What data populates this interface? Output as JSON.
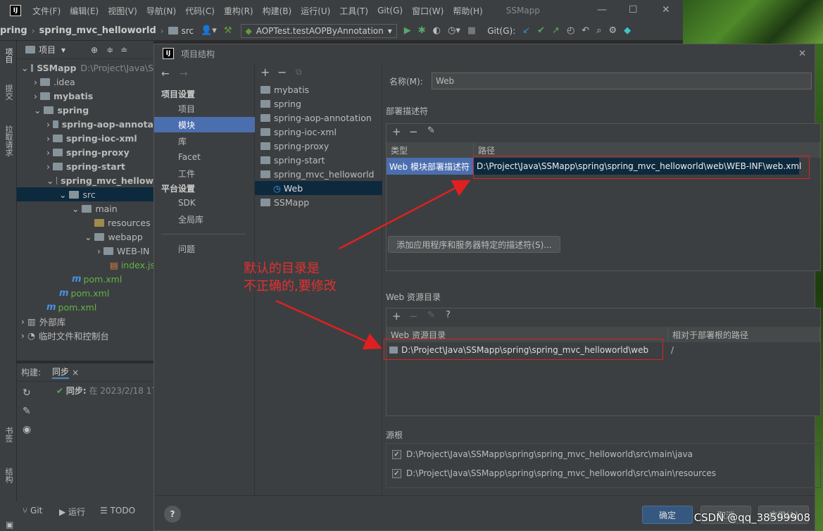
{
  "menubar": {
    "logo": "IJ",
    "items": [
      "文件(F)",
      "编辑(E)",
      "视图(V)",
      "导航(N)",
      "代码(C)",
      "重构(R)",
      "构建(B)",
      "运行(U)",
      "工具(T)",
      "Git(G)",
      "窗口(W)",
      "帮助(H)"
    ],
    "app_title": "SSMapp"
  },
  "toolbar": {
    "crumb1": "pring",
    "crumb2": "spring_mvc_helloworld",
    "crumb3": "src",
    "run_config": "AOPTest.testAOPByAnnotation",
    "git_label": "Git(G):"
  },
  "left_strip": {
    "tab_project": "项目",
    "tab_commit": "提交",
    "tab_pr": "拉取请求",
    "tab_bookmarks": "书签",
    "tab_structure": "结构"
  },
  "project_panel": {
    "header": "项目",
    "rows": [
      {
        "text": "SSMapp",
        "extra": "D:\\Project\\Java\\S"
      },
      {
        "text": ".idea"
      },
      {
        "text": "mybatis"
      },
      {
        "text": "spring"
      },
      {
        "text": "spring-aop-annota"
      },
      {
        "text": "spring-ioc-xml"
      },
      {
        "text": "spring-proxy"
      },
      {
        "text": "spring-start"
      },
      {
        "text": "spring_mvc_hellow"
      },
      {
        "text": "src"
      },
      {
        "text": "main"
      },
      {
        "text": "resources"
      },
      {
        "text": "webapp"
      },
      {
        "text": "WEB-IN"
      },
      {
        "text": "index.js"
      },
      {
        "text": "pom.xml"
      },
      {
        "text": "pom.xml"
      },
      {
        "text": "pom.xml"
      },
      {
        "text": "外部库"
      },
      {
        "text": "临时文件和控制台"
      }
    ]
  },
  "build_panel": {
    "tab_build": "构建:",
    "tab_sync": "同步",
    "sync_status": "同步:",
    "sync_time": "在 2023/2/18 17"
  },
  "statusbar": {
    "git": "Git",
    "run": "运行",
    "todo": "TODO"
  },
  "dialog": {
    "title": "项目结构",
    "logo": "IJ",
    "nav": {
      "project_settings": "项目设置",
      "items1": [
        "项目",
        "模块",
        "库",
        "Facet",
        "工件"
      ],
      "platform_settings": "平台设置",
      "items2": [
        "SDK",
        "全局库"
      ],
      "problems": "问题"
    },
    "modules": [
      "mybatis",
      "spring",
      "spring-aop-annotation",
      "spring-ioc-xml",
      "spring-proxy",
      "spring-start",
      "spring_mvc_helloworld",
      "Web",
      "SSMapp"
    ],
    "name_label": "名称(M):",
    "name_value": "Web",
    "deploy_section": "部署描述符",
    "deploy_headers": {
      "type": "类型",
      "path": "路径"
    },
    "deploy_row": {
      "type": "Web 模块部署描述符",
      "path": "D:\\Project\\Java\\SSMapp\\spring\\spring_mvc_helloworld\\web\\WEB-INF\\web.xml"
    },
    "add_descriptor_btn": "添加应用程序和服务器特定的描述符(S)...",
    "webres_section": "Web 资源目录",
    "webres_headers": {
      "dir": "Web 资源目录",
      "relpath": "相对于部署根的路径"
    },
    "webres_row": {
      "dir": "D:\\Project\\Java\\SSMapp\\spring\\spring_mvc_helloworld\\web",
      "relpath": "/"
    },
    "source_section": "源根",
    "sources": [
      "D:\\Project\\Java\\SSMapp\\spring\\spring_mvc_helloworld\\src\\main\\java",
      "D:\\Project\\Java\\SSMapp\\spring\\spring_mvc_helloworld\\src\\main\\resources"
    ],
    "ok": "确定",
    "cancel": "取消",
    "apply": "应用(A)",
    "help": "?"
  },
  "annotation": {
    "line1": "默认的目录是",
    "line2": "不正确的,要修改"
  },
  "watermark": "CSDN @qq_38599908",
  "colors": {
    "selection": "#4b6eaf",
    "annotation_red": "#e02020",
    "primary_button": "#365880"
  }
}
